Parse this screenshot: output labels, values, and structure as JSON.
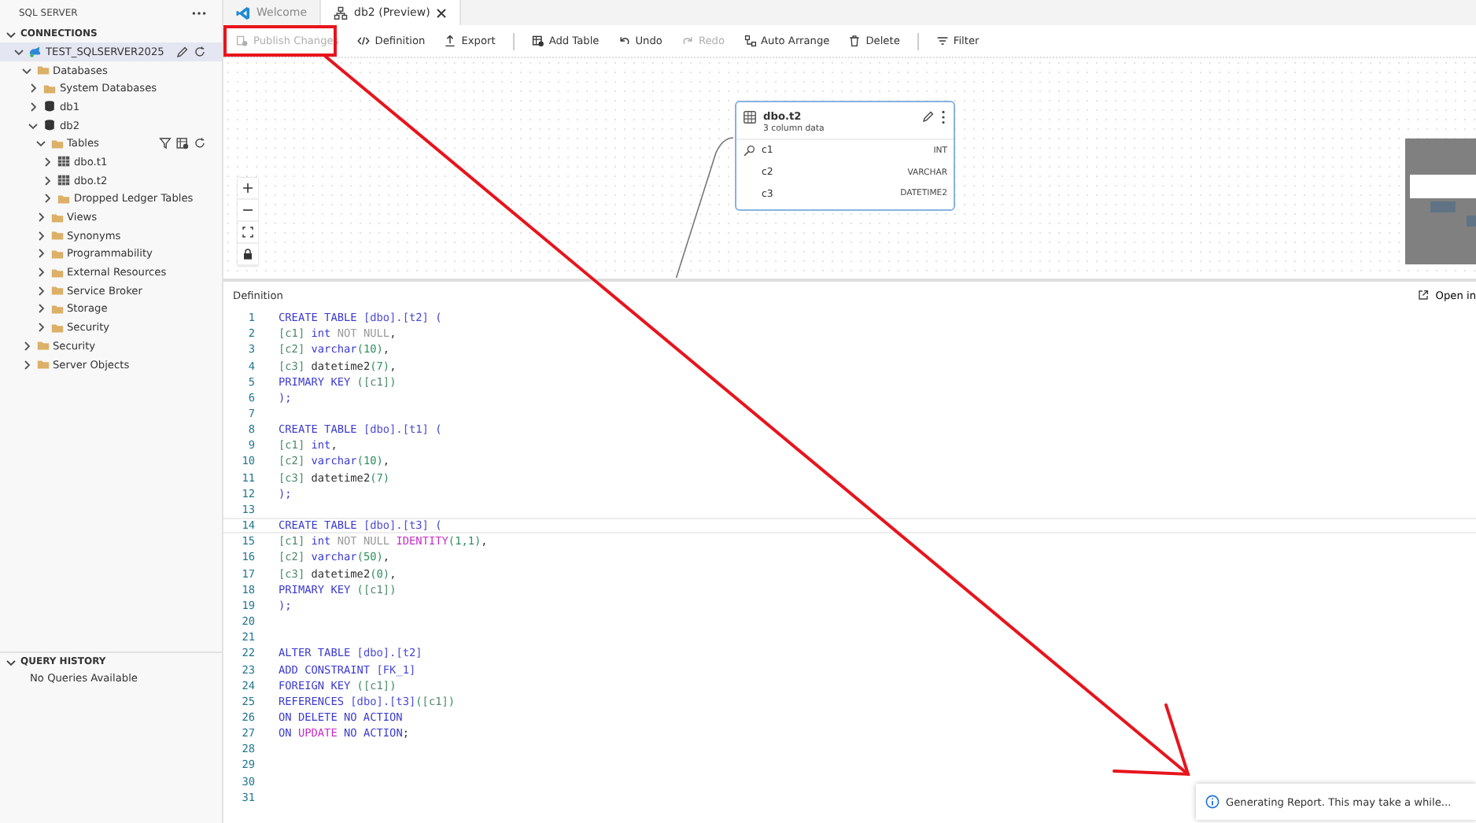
{
  "sidebar": {
    "title": "SQL SERVER",
    "connections": {
      "label": "CONNECTIONS",
      "expanded": true,
      "tree": [
        {
          "name": "TEST_SQLSERVER2025",
          "kind": "server",
          "expanded": true,
          "selected": true,
          "children": [
            {
              "name": "Databases",
              "kind": "folder",
              "expanded": true,
              "selected": false,
              "children": [
                {
                  "name": "System Databases",
                  "kind": "folder",
                  "expanded": false,
                  "selected": false
                },
                {
                  "name": "db1",
                  "kind": "database",
                  "expanded": false,
                  "selected": false
                },
                {
                  "name": "db2",
                  "kind": "database",
                  "expanded": true,
                  "selected": false,
                  "children": [
                    {
                      "name": "Tables",
                      "kind": "tables-folder",
                      "expanded": true,
                      "selected": false,
                      "children": [
                        {
                          "name": "dbo.t1",
                          "kind": "table",
                          "expanded": false,
                          "selected": false
                        },
                        {
                          "name": "dbo.t2",
                          "kind": "table",
                          "expanded": false,
                          "selected": false
                        },
                        {
                          "name": "Dropped Ledger Tables",
                          "kind": "folder",
                          "expanded": false,
                          "selected": false
                        }
                      ]
                    },
                    {
                      "name": "Views",
                      "kind": "folder",
                      "expanded": false,
                      "selected": false
                    },
                    {
                      "name": "Synonyms",
                      "kind": "folder",
                      "expanded": false,
                      "selected": false
                    },
                    {
                      "name": "Programmability",
                      "kind": "folder",
                      "expanded": false,
                      "selected": false
                    },
                    {
                      "name": "External Resources",
                      "kind": "folder",
                      "expanded": false,
                      "selected": false
                    },
                    {
                      "name": "Service Broker",
                      "kind": "folder",
                      "expanded": false,
                      "selected": false
                    },
                    {
                      "name": "Storage",
                      "kind": "folder",
                      "expanded": false,
                      "selected": false
                    },
                    {
                      "name": "Security",
                      "kind": "folder",
                      "expanded": false,
                      "selected": false
                    }
                  ]
                }
              ]
            },
            {
              "name": "Security",
              "kind": "folder",
              "expanded": false,
              "selected": false
            },
            {
              "name": "Server Objects",
              "kind": "folder",
              "expanded": false,
              "selected": false
            }
          ]
        }
      ]
    },
    "query_history": {
      "label": "QUERY HISTORY",
      "expanded": true,
      "empty_text": "No Queries Available"
    }
  },
  "tabs": [
    {
      "label": "Welcome",
      "kind": "welcome",
      "selected": false
    },
    {
      "label": "db2 (Preview)",
      "kind": "diagram",
      "selected": true
    }
  ],
  "toolbar": {
    "groups": [
      [
        {
          "label": "Publish Changes",
          "kind": "publish",
          "disabled": true
        },
        {
          "label": "Definition",
          "kind": "code",
          "disabled": false
        },
        {
          "label": "Export",
          "kind": "export",
          "disabled": false
        }
      ],
      [
        {
          "label": "Add Table",
          "kind": "add-table",
          "disabled": false
        },
        {
          "label": "Undo",
          "kind": "undo",
          "disabled": false
        },
        {
          "label": "Redo",
          "kind": "redo",
          "disabled": true
        },
        {
          "label": "Auto Arrange",
          "kind": "arrange",
          "disabled": false
        },
        {
          "label": "Delete",
          "kind": "delete",
          "disabled": false
        }
      ],
      [
        {
          "label": "Filter",
          "kind": "filter",
          "disabled": false
        }
      ]
    ]
  },
  "canvas": {
    "table_card": {
      "title": "dbo.t2",
      "subtitle": "3 column data",
      "columns": [
        {
          "name": "c1",
          "type": "INT",
          "key": true
        },
        {
          "name": "c2",
          "type": "VARCHAR",
          "key": false
        },
        {
          "name": "c3",
          "type": "DATETIME2",
          "key": false
        }
      ]
    }
  },
  "definition": {
    "title": "Definition",
    "open_in": "Open in",
    "lines": [
      {
        "n": "1",
        "selected": false,
        "tokens": [
          {
            "kind": "kw",
            "t": "CREATE TABLE "
          },
          {
            "kind": "ref",
            "t": "[dbo].[t2]"
          },
          {
            "kind": "kw",
            "t": " ("
          }
        ]
      },
      {
        "n": "2",
        "selected": false,
        "tokens": [
          {
            "kind": "col",
            "t": "[c1]"
          },
          {
            "kind": "kw",
            "t": " int"
          },
          {
            "kind": "gray",
            "t": " NOT NULL"
          },
          {
            "kind": "txt",
            "t": ","
          }
        ]
      },
      {
        "n": "3",
        "selected": false,
        "tokens": [
          {
            "kind": "col",
            "t": "[c2]"
          },
          {
            "kind": "kw",
            "t": " varchar"
          },
          {
            "kind": "num",
            "t": "(10)"
          },
          {
            "kind": "txt",
            "t": ","
          }
        ]
      },
      {
        "n": "4",
        "selected": false,
        "tokens": [
          {
            "kind": "col",
            "t": "[c3]"
          },
          {
            "kind": "txt",
            "t": " datetime2"
          },
          {
            "kind": "num",
            "t": "(7)"
          },
          {
            "kind": "txt",
            "t": ","
          }
        ]
      },
      {
        "n": "5",
        "selected": false,
        "tokens": [
          {
            "kind": "kw",
            "t": "PRIMARY KEY "
          },
          {
            "kind": "num",
            "t": "("
          },
          {
            "kind": "col",
            "t": "[c1]"
          },
          {
            "kind": "num",
            "t": ")"
          }
        ]
      },
      {
        "n": "6",
        "selected": false,
        "tokens": [
          {
            "kind": "kw",
            "t": ");"
          }
        ]
      },
      {
        "n": "7",
        "selected": false
      },
      {
        "n": "8",
        "selected": false,
        "tokens": [
          {
            "kind": "kw",
            "t": "CREATE TABLE "
          },
          {
            "kind": "ref",
            "t": "[dbo].[t1]"
          },
          {
            "kind": "kw",
            "t": " ("
          }
        ]
      },
      {
        "n": "9",
        "selected": false,
        "tokens": [
          {
            "kind": "col",
            "t": "[c1]"
          },
          {
            "kind": "kw",
            "t": " int"
          },
          {
            "kind": "txt",
            "t": ","
          }
        ]
      },
      {
        "n": "10",
        "selected": false,
        "tokens": [
          {
            "kind": "col",
            "t": "[c2]"
          },
          {
            "kind": "kw",
            "t": " varchar"
          },
          {
            "kind": "num",
            "t": "(10)"
          },
          {
            "kind": "txt",
            "t": ","
          }
        ]
      },
      {
        "n": "11",
        "selected": false,
        "tokens": [
          {
            "kind": "col",
            "t": "[c3]"
          },
          {
            "kind": "txt",
            "t": " datetime2"
          },
          {
            "kind": "num",
            "t": "(7)"
          }
        ]
      },
      {
        "n": "12",
        "selected": false,
        "tokens": [
          {
            "kind": "kw",
            "t": ");"
          }
        ]
      },
      {
        "n": "13",
        "selected": false
      },
      {
        "n": "14",
        "selected": true,
        "tokens": [
          {
            "kind": "kw",
            "t": "CREATE TABLE "
          },
          {
            "kind": "ref",
            "t": "[dbo].[t3]"
          },
          {
            "kind": "kw",
            "t": " ("
          }
        ]
      },
      {
        "n": "15",
        "selected": false,
        "tokens": [
          {
            "kind": "col",
            "t": "[c1]"
          },
          {
            "kind": "kw",
            "t": " int"
          },
          {
            "kind": "gray",
            "t": " NOT NULL "
          },
          {
            "kind": "fn",
            "t": "IDENTITY"
          },
          {
            "kind": "num",
            "t": "(1,1)"
          },
          {
            "kind": "txt",
            "t": ","
          }
        ]
      },
      {
        "n": "16",
        "selected": false,
        "tokens": [
          {
            "kind": "col",
            "t": "[c2]"
          },
          {
            "kind": "kw",
            "t": " varchar"
          },
          {
            "kind": "num",
            "t": "(50)"
          },
          {
            "kind": "txt",
            "t": ","
          }
        ]
      },
      {
        "n": "17",
        "selected": false,
        "tokens": [
          {
            "kind": "col",
            "t": "[c3]"
          },
          {
            "kind": "txt",
            "t": " datetime2"
          },
          {
            "kind": "num",
            "t": "(0)"
          },
          {
            "kind": "txt",
            "t": ","
          }
        ]
      },
      {
        "n": "18",
        "selected": false,
        "tokens": [
          {
            "kind": "kw",
            "t": "PRIMARY KEY "
          },
          {
            "kind": "num",
            "t": "("
          },
          {
            "kind": "col",
            "t": "[c1]"
          },
          {
            "kind": "num",
            "t": ")"
          }
        ]
      },
      {
        "n": "19",
        "selected": false,
        "tokens": [
          {
            "kind": "kw",
            "t": ");"
          }
        ]
      },
      {
        "n": "20",
        "selected": false
      },
      {
        "n": "21",
        "selected": false
      },
      {
        "n": "22",
        "selected": false,
        "tokens": [
          {
            "kind": "kw",
            "t": "ALTER TABLE "
          },
          {
            "kind": "ref",
            "t": "[dbo].[t2]"
          }
        ]
      },
      {
        "n": "23",
        "selected": false,
        "tokens": [
          {
            "kind": "kw",
            "t": "ADD CONSTRAINT "
          },
          {
            "kind": "ref",
            "t": "[FK_1]"
          }
        ]
      },
      {
        "n": "24",
        "selected": false,
        "tokens": [
          {
            "kind": "kw",
            "t": "FOREIGN KEY "
          },
          {
            "kind": "num",
            "t": "("
          },
          {
            "kind": "col",
            "t": "[c1]"
          },
          {
            "kind": "num",
            "t": ")"
          }
        ]
      },
      {
        "n": "25",
        "selected": false,
        "tokens": [
          {
            "kind": "kw",
            "t": "REFERENCES "
          },
          {
            "kind": "ref",
            "t": "[dbo].[t3]"
          },
          {
            "kind": "num",
            "t": "("
          },
          {
            "kind": "col",
            "t": "[c1]"
          },
          {
            "kind": "num",
            "t": ")"
          }
        ]
      },
      {
        "n": "26",
        "selected": false,
        "tokens": [
          {
            "kind": "kw",
            "t": "ON DELETE NO ACTION"
          }
        ]
      },
      {
        "n": "27",
        "selected": false,
        "tokens": [
          {
            "kind": "kw",
            "t": "ON "
          },
          {
            "kind": "fn",
            "t": "UPDATE"
          },
          {
            "kind": "kw",
            "t": " NO ACTION"
          },
          {
            "kind": "txt",
            "t": ";"
          }
        ]
      },
      {
        "n": "28",
        "selected": false
      },
      {
        "n": "29",
        "selected": false
      },
      {
        "n": "30",
        "selected": false
      },
      {
        "n": "31",
        "selected": false
      }
    ]
  },
  "notification": {
    "kind": "info",
    "message": "Generating Report. This may take a while..."
  }
}
